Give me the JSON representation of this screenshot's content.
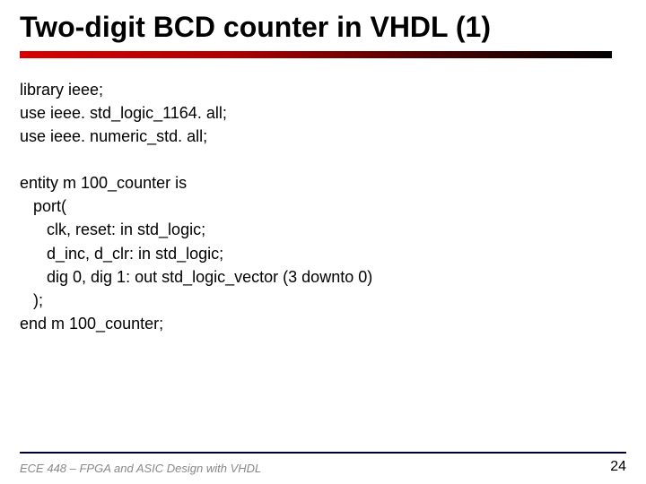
{
  "title": "Two-digit BCD counter in VHDL (1)",
  "code": {
    "l0": "library ieee;",
    "l1": "use ieee. std_logic_1164. all;",
    "l2": "use ieee. numeric_std. all;",
    "l3": "entity m 100_counter is",
    "l4": "   port(",
    "l5": "      clk, reset: in std_logic;",
    "l6": "      d_inc, d_clr: in std_logic;",
    "l7": "      dig 0, dig 1: out std_logic_vector (3 downto 0)",
    "l8": "   );",
    "l9": "end m 100_counter;"
  },
  "footer": {
    "left": "ECE 448 – FPGA and ASIC Design with VHDL",
    "page": "24"
  }
}
